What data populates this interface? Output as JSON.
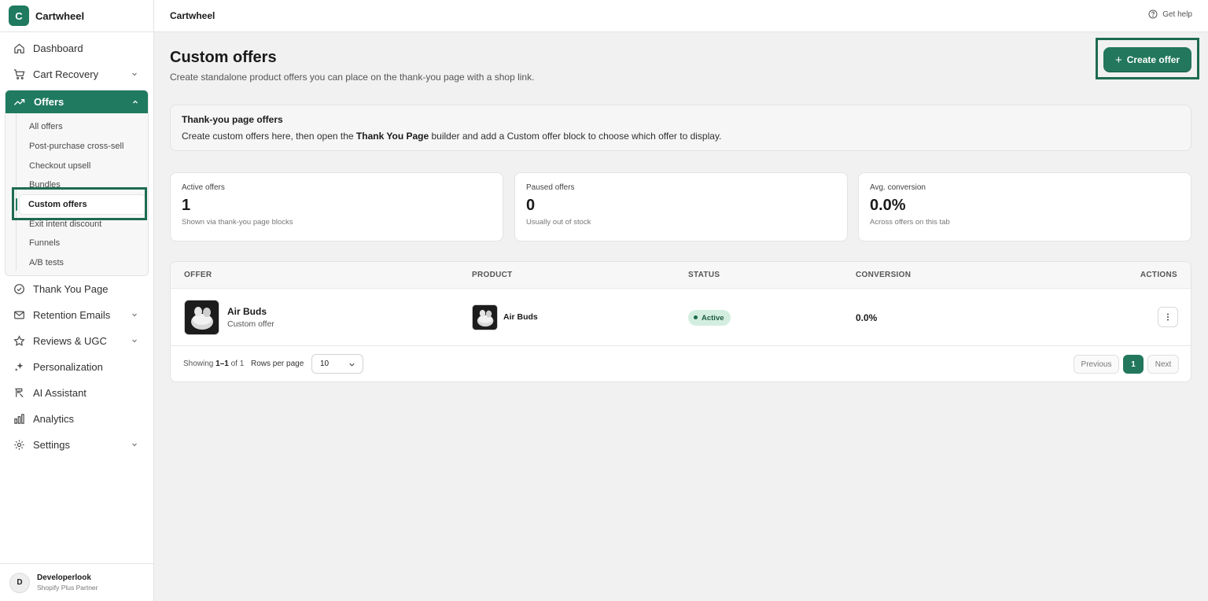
{
  "app": {
    "logo_letter": "C",
    "name": "Cartwheel"
  },
  "sidebar": {
    "items": [
      {
        "label": "Dashboard",
        "icon": "home-icon"
      },
      {
        "label": "Cart Recovery",
        "icon": "cart-icon",
        "expandable": true
      },
      {
        "label": "Offers",
        "icon": "trending-up-icon",
        "expanded": true,
        "active": true
      },
      {
        "label": "Thank You Page",
        "icon": "check-circle-icon"
      },
      {
        "label": "Retention Emails",
        "icon": "mail-icon",
        "expandable": true
      },
      {
        "label": "Reviews & UGC",
        "icon": "star-icon",
        "expandable": true
      },
      {
        "label": "Personalization",
        "icon": "sparkle-icon"
      },
      {
        "label": "AI Assistant",
        "icon": "assistant-icon"
      },
      {
        "label": "Analytics",
        "icon": "bar-chart-icon"
      },
      {
        "label": "Settings",
        "icon": "gear-icon",
        "expandable": true
      }
    ],
    "offers_sub": [
      "All offers",
      "Post-purchase cross-sell",
      "Checkout upsell",
      "Bundles",
      "Custom offers",
      "Exit intent discount",
      "Funnels",
      "A/B tests"
    ],
    "offers_active_sub": "Custom offers",
    "user": {
      "initial": "D",
      "name": "Developerlook",
      "role": "Shopify Plus Partner"
    }
  },
  "topbar": {
    "title": "Cartwheel",
    "help": "Get help"
  },
  "page": {
    "title": "Custom offers",
    "subtitle": "Create standalone product offers you can place on the thank-you page with a shop link.",
    "create_button": "Create offer"
  },
  "banner": {
    "title": "Thank-you page offers",
    "text_before": "Create custom offers here, then open the ",
    "text_bold": "Thank You Page",
    "text_after": " builder and add a Custom offer block to choose which offer to display."
  },
  "stats": [
    {
      "label": "Active offers",
      "value": "1",
      "help": "Shown via thank-you page blocks"
    },
    {
      "label": "Paused offers",
      "value": "0",
      "help": "Usually out of stock"
    },
    {
      "label": "Avg. conversion",
      "value": "0.0%",
      "help": "Across offers on this tab"
    }
  ],
  "table": {
    "headers": {
      "offer": "OFFER",
      "product": "PRODUCT",
      "status": "STATUS",
      "conversion": "CONVERSION",
      "actions": "ACTIONS"
    },
    "rows": [
      {
        "offer_name": "Air Buds",
        "offer_type": "Custom offer",
        "product": "Air Buds",
        "status": "Active",
        "conversion": "0.0%"
      }
    ],
    "footer": {
      "showing_prefix": "Showing ",
      "showing_range": "1–1",
      "showing_suffix": " of 1",
      "rows_per_page_label": "Rows per page",
      "rows_per_page": "10",
      "prev": "Previous",
      "page": "1",
      "next": "Next"
    }
  },
  "colors": {
    "accent": "#1f7a5f",
    "badge_bg": "#d3eee0",
    "highlight": "#1e6b4f"
  }
}
